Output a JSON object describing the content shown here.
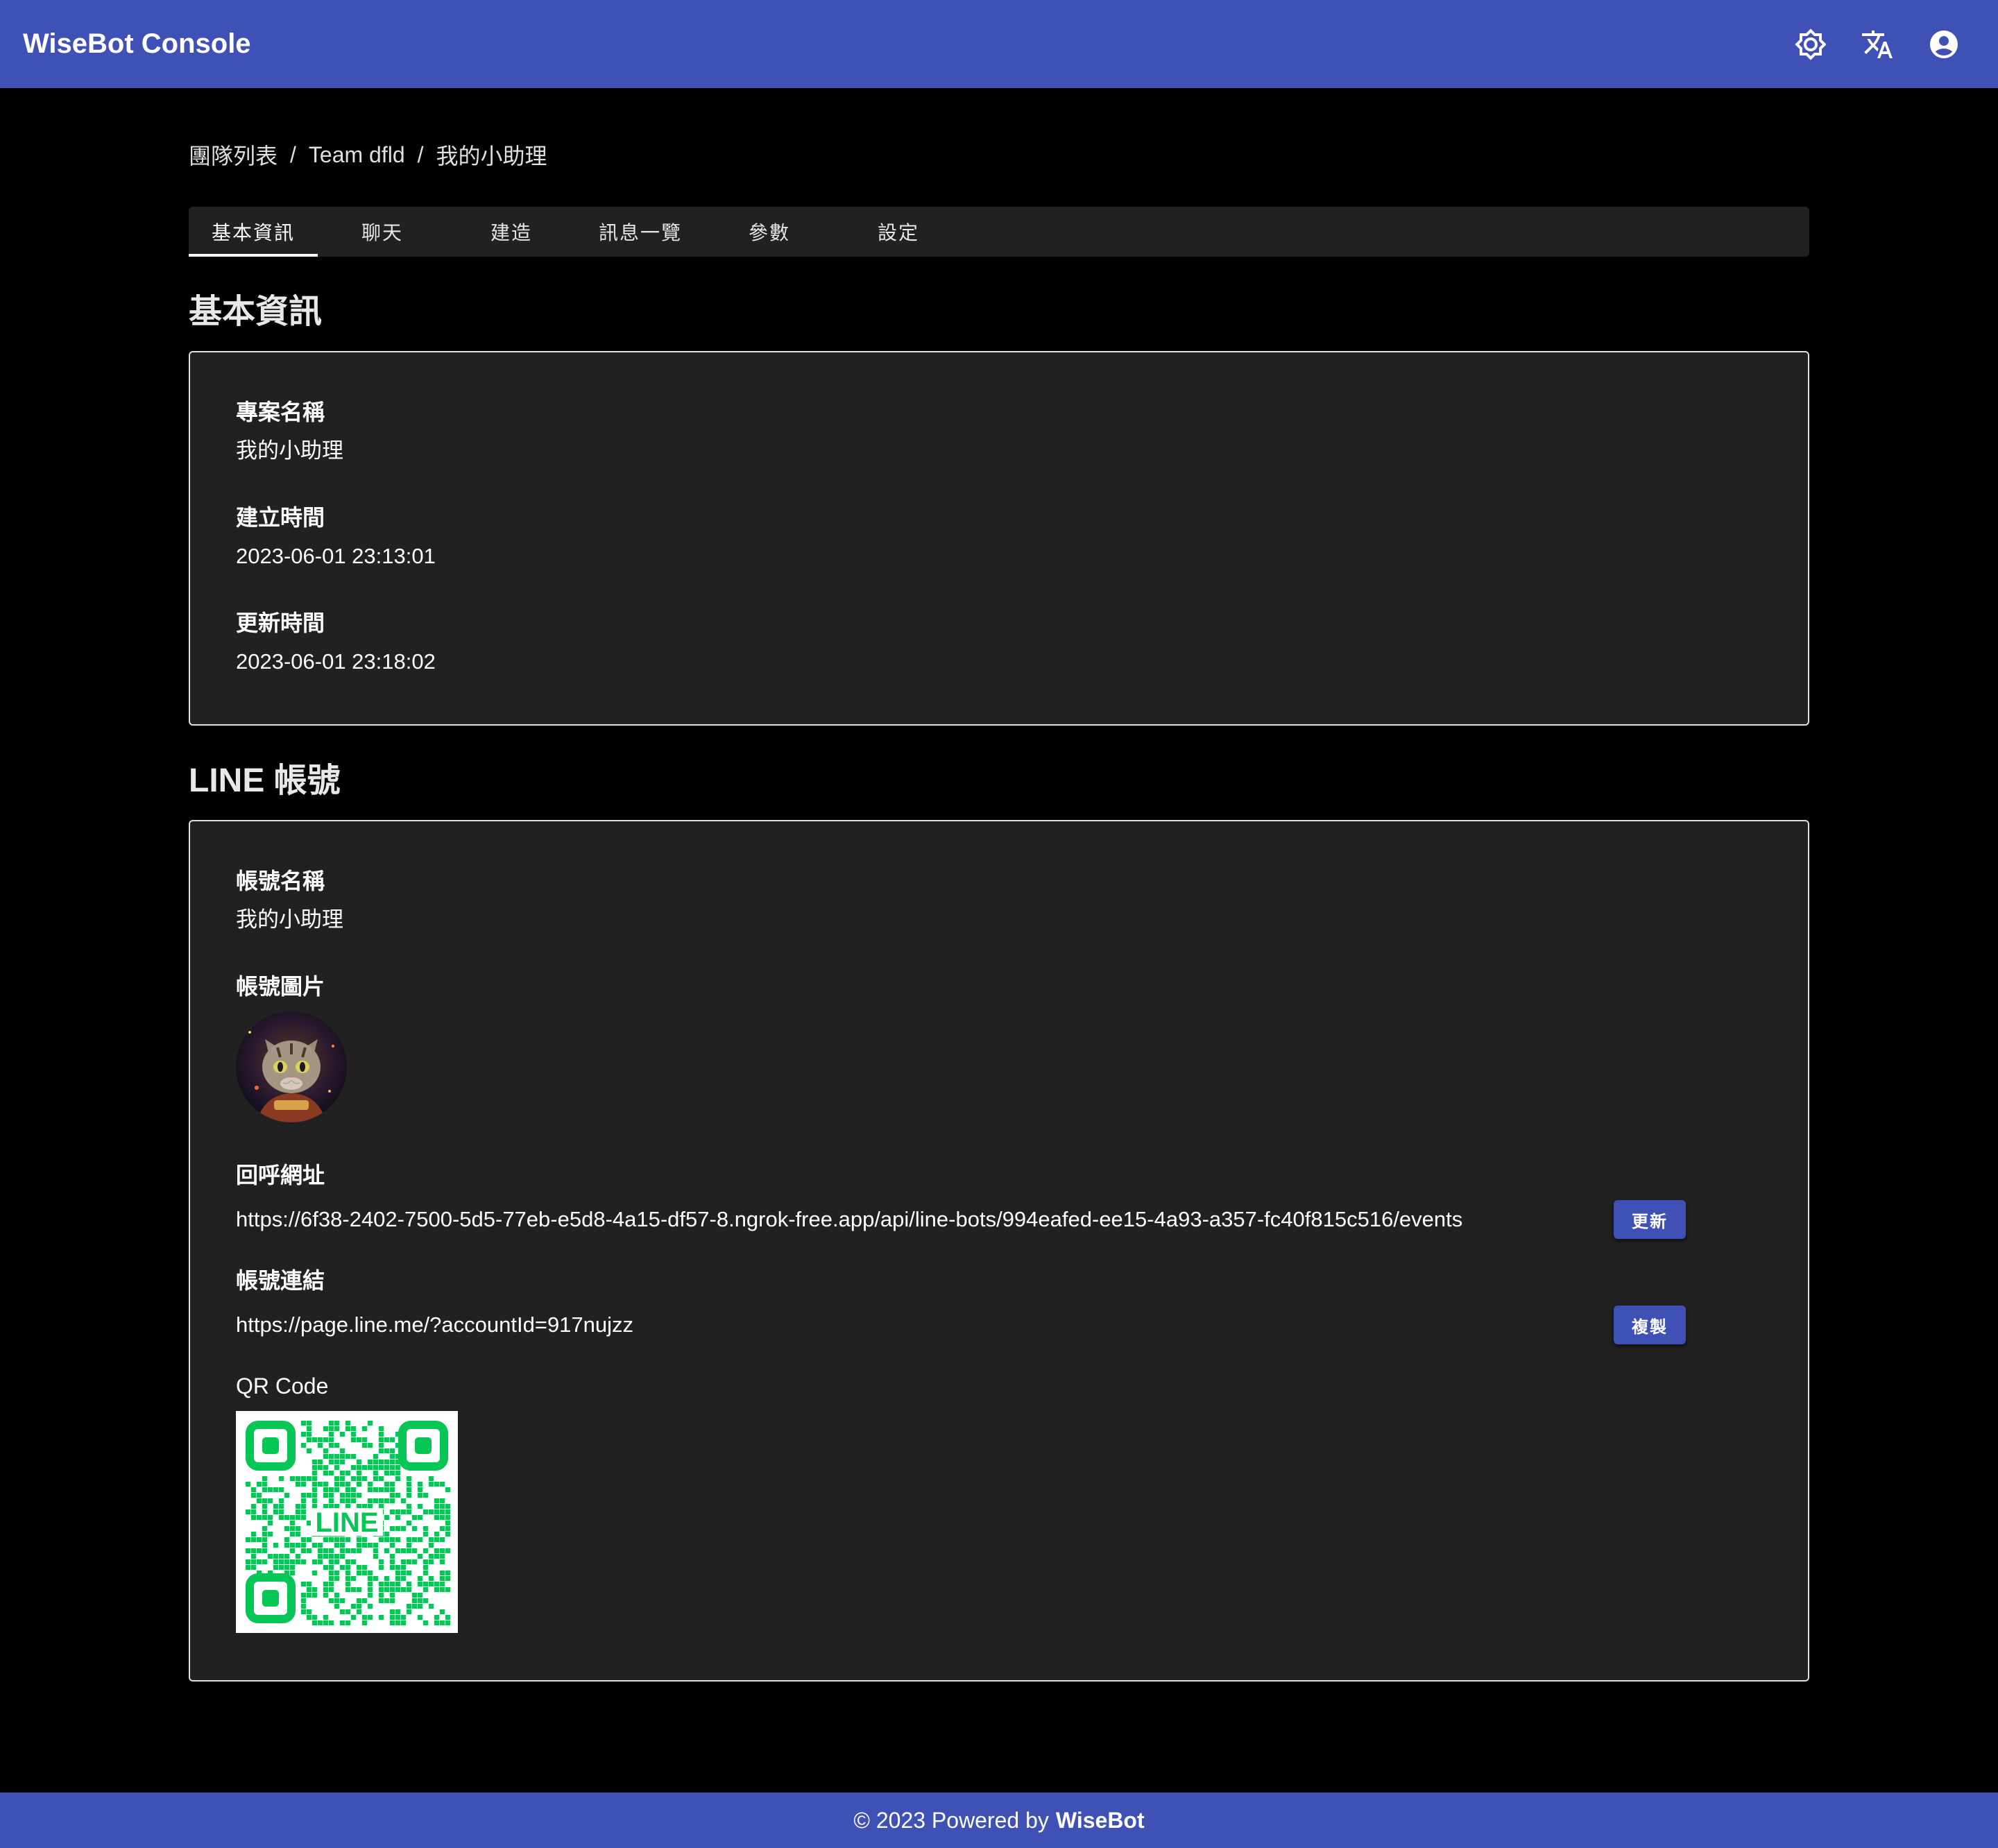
{
  "app": {
    "title": "WiseBot Console"
  },
  "header": {
    "icons": [
      "brightness-icon",
      "translate-icon",
      "account-icon"
    ]
  },
  "breadcrumb": {
    "items": [
      "團隊列表",
      "Team dfld",
      "我的小助理"
    ],
    "separator": "/"
  },
  "tabs": {
    "items": [
      "基本資訊",
      "聊天",
      "建造",
      "訊息一覽",
      "參數",
      "設定"
    ],
    "active": "基本資訊"
  },
  "basic_info": {
    "title": "基本資訊",
    "project_name_label": "專案名稱",
    "project_name": "我的小助理",
    "created_label": "建立時間",
    "created_at": "2023-06-01 23:13:01",
    "updated_label": "更新時間",
    "updated_at": "2023-06-01 23:18:02"
  },
  "line_account": {
    "title": "LINE 帳號",
    "account_name_label": "帳號名稱",
    "account_name": "我的小助理",
    "picture_label": "帳號圖片",
    "callback_label": "回呼網址",
    "callback_url": "https://6f38-2402-7500-5d5-77eb-e5d8-4a15-df57-8.ngrok-free.app/api/line-bots/994eafed-ee15-4a93-a357-fc40f815c516/events",
    "update_button": "更新",
    "link_label": "帳號連結",
    "link_url": "https://page.line.me/?accountId=917nujzz",
    "copy_button": "複製",
    "qr_label": "QR Code",
    "qr_text": "LINE"
  },
  "footer": {
    "prefix": "© 2023 Powered by",
    "brand": "WiseBot"
  },
  "colors": {
    "primary": "#3f51b5",
    "background": "#000000",
    "card": "#212121",
    "line_green": "#06c755"
  }
}
